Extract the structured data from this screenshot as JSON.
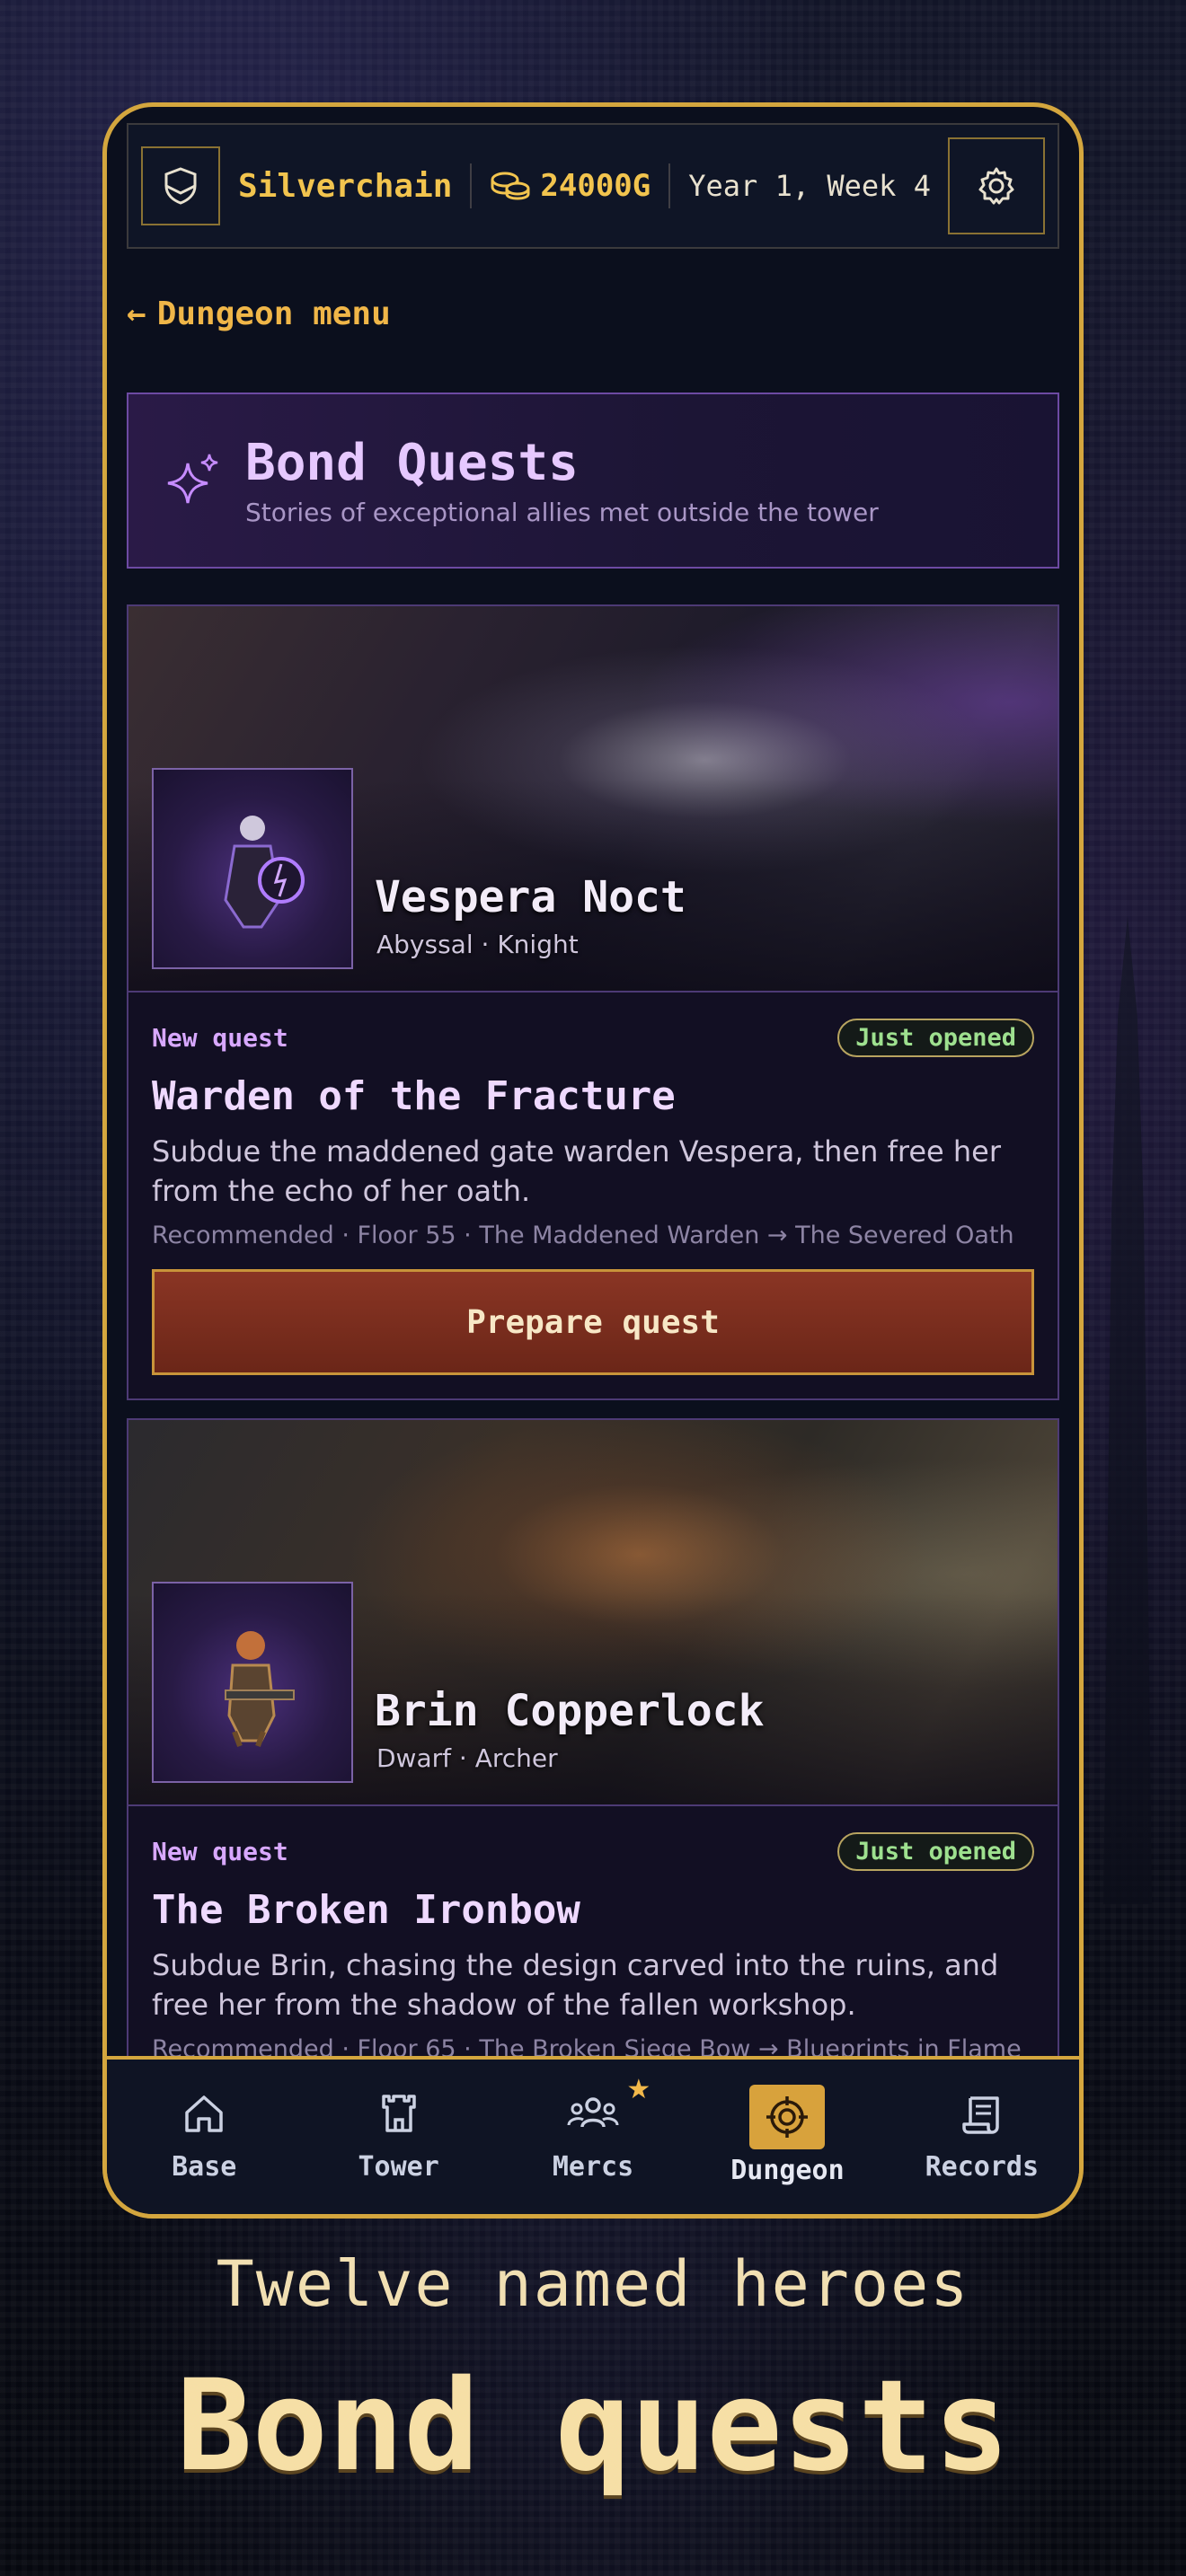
{
  "header": {
    "guild_name": "Silverchain",
    "gold": "24000G",
    "date": "Year 1, Week 4"
  },
  "back_link": {
    "label": "Dungeon menu"
  },
  "banner": {
    "title": "Bond Quests",
    "subtitle": "Stories of exceptional allies met outside the tower"
  },
  "quests": [
    {
      "hero_name": "Vespera Noct",
      "hero_meta": "Abyssal · Knight",
      "tag": "New quest",
      "status": "Just opened",
      "title": "Warden of the Fracture",
      "description": "Subdue the maddened gate warden Vespera, then free her from the echo of her oath.",
      "recommended": "Recommended · Floor 55 · The Maddened Warden → The Severed Oath",
      "action": "Prepare quest"
    },
    {
      "hero_name": "Brin Copperlock",
      "hero_meta": "Dwarf · Archer",
      "tag": "New quest",
      "status": "Just opened",
      "title": "The Broken Ironbow",
      "description": "Subdue Brin, chasing the design carved into the ruins, and free her from the shadow of the fallen workshop.",
      "recommended": "Recommended · Floor 65 · The Broken Siege Bow → Blueprints in Flame"
    }
  ],
  "nav": {
    "items": [
      {
        "label": "Base",
        "icon": "home-icon"
      },
      {
        "label": "Tower",
        "icon": "tower-icon"
      },
      {
        "label": "Mercs",
        "icon": "group-icon"
      },
      {
        "label": "Dungeon",
        "icon": "target-icon",
        "active": true
      },
      {
        "label": "Records",
        "icon": "scroll-icon"
      }
    ]
  },
  "caption": {
    "line1": "Twelve named heroes",
    "line2": "Bond quests"
  },
  "colors": {
    "accent_gold": "#d4a63e",
    "quest_purple": "#d8a8ff",
    "status_green": "#9ee08f",
    "button_red": "#8a3524"
  }
}
